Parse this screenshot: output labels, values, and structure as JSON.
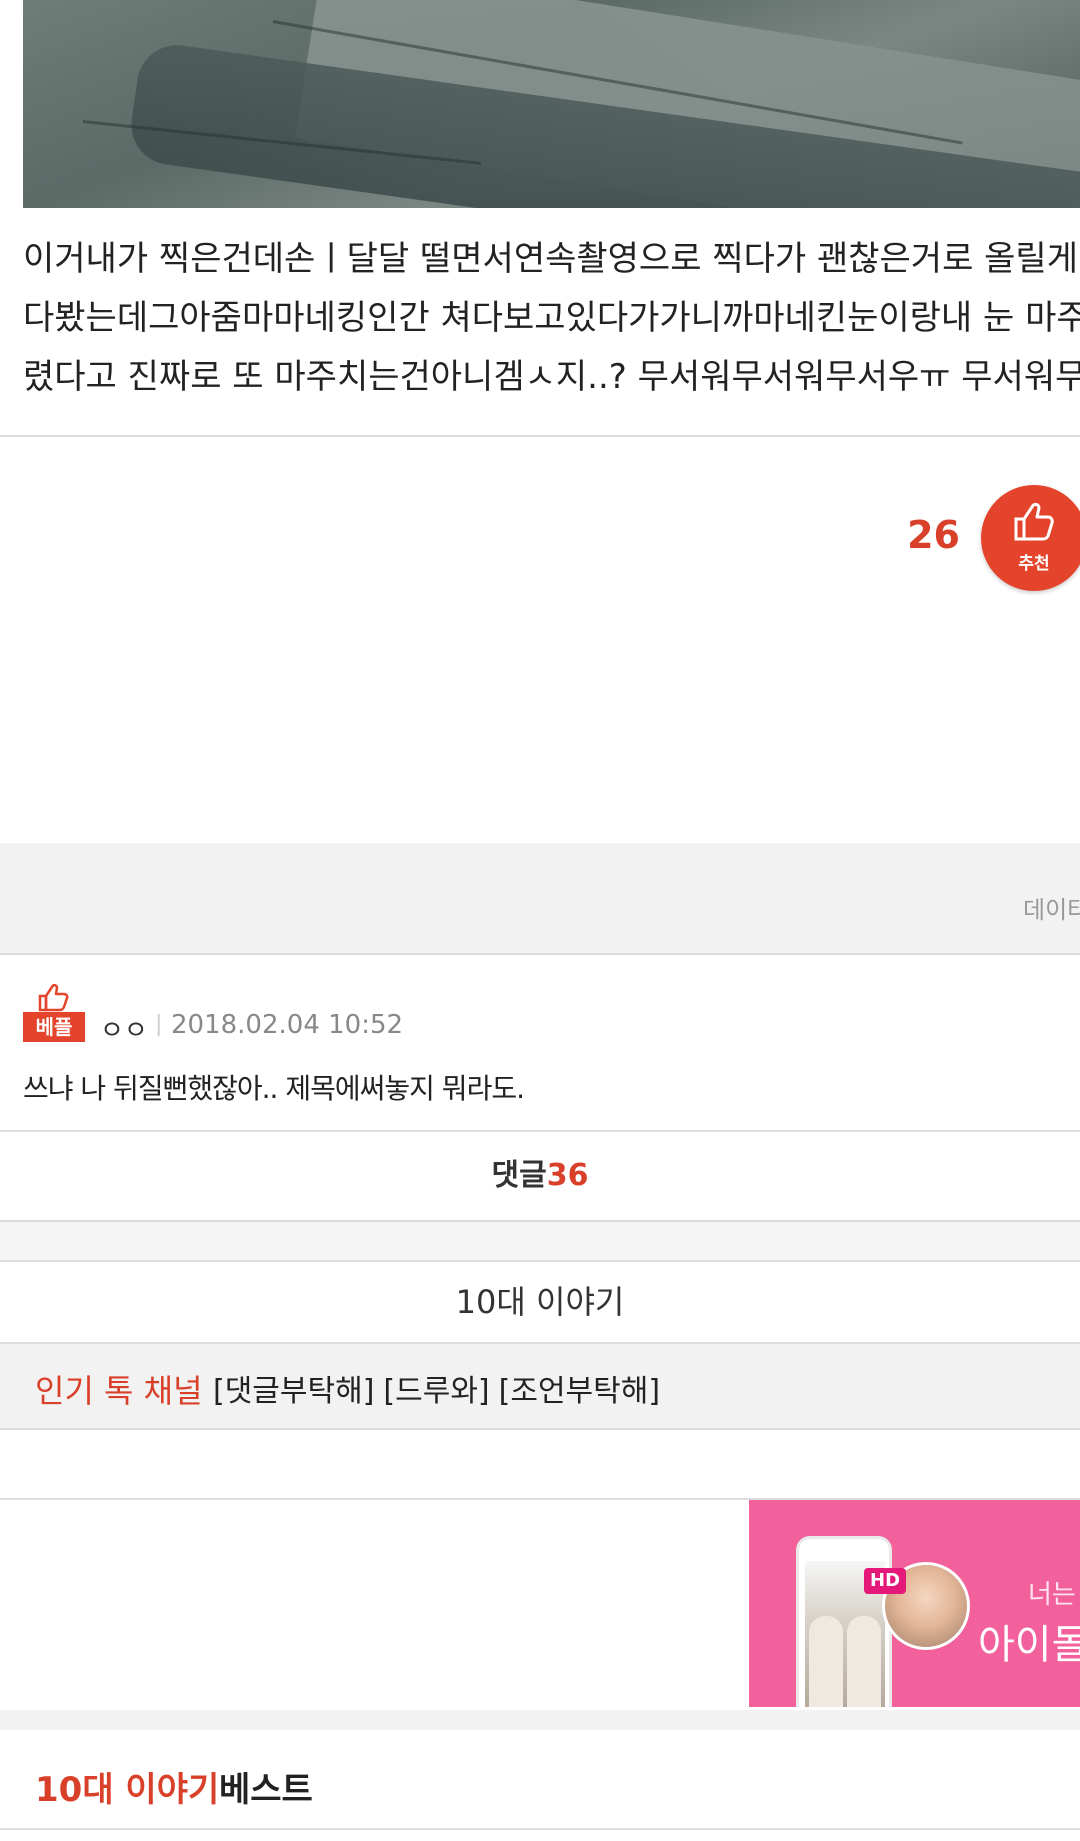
{
  "post": {
    "lines": [
      "이거내가 찍은건데손ㅣ달달 떨면서연속촬영으로 찍다가 괜찮은거로 올릴게 찍",
      "다봤는데그아줌마마네킹인간 쳐다보고있다가가니까마네킨눈이랑내 눈 마주쳤",
      "렸다고 진짜로 또 마주치는건아니겜ㅅ지..? 무서워무서워무서우ㅠ 무서워무서"
    ]
  },
  "recommend": {
    "count": "26",
    "label": "추천"
  },
  "data_label": "데이터",
  "best_comment": {
    "badge": "베플",
    "author": "ㅇㅇ",
    "separator": "|",
    "date": "2018.02.04 10:52",
    "text": "쓰냐 나 뒤질뻔했잖아.. 제목에써놓지 뭐라도."
  },
  "comments": {
    "label": "댓글",
    "count": "36"
  },
  "channel": {
    "title": "10대 이야기"
  },
  "hot_channel": {
    "label": "인기 톡 채널",
    "links": [
      "[댓글부탁해]",
      "[드루와]",
      "[조언부탁해]"
    ]
  },
  "ad": {
    "hd": "HD",
    "line1": "너는",
    "line2": "아이돌"
  },
  "best_section": {
    "channel": "10대 이야기",
    "suffix": "베스트"
  },
  "colors": {
    "accent": "#e4442b",
    "accent_text": "#d9402a",
    "ad_pink": "#f2619c"
  },
  "icons": [
    "thumbs-up-icon"
  ]
}
